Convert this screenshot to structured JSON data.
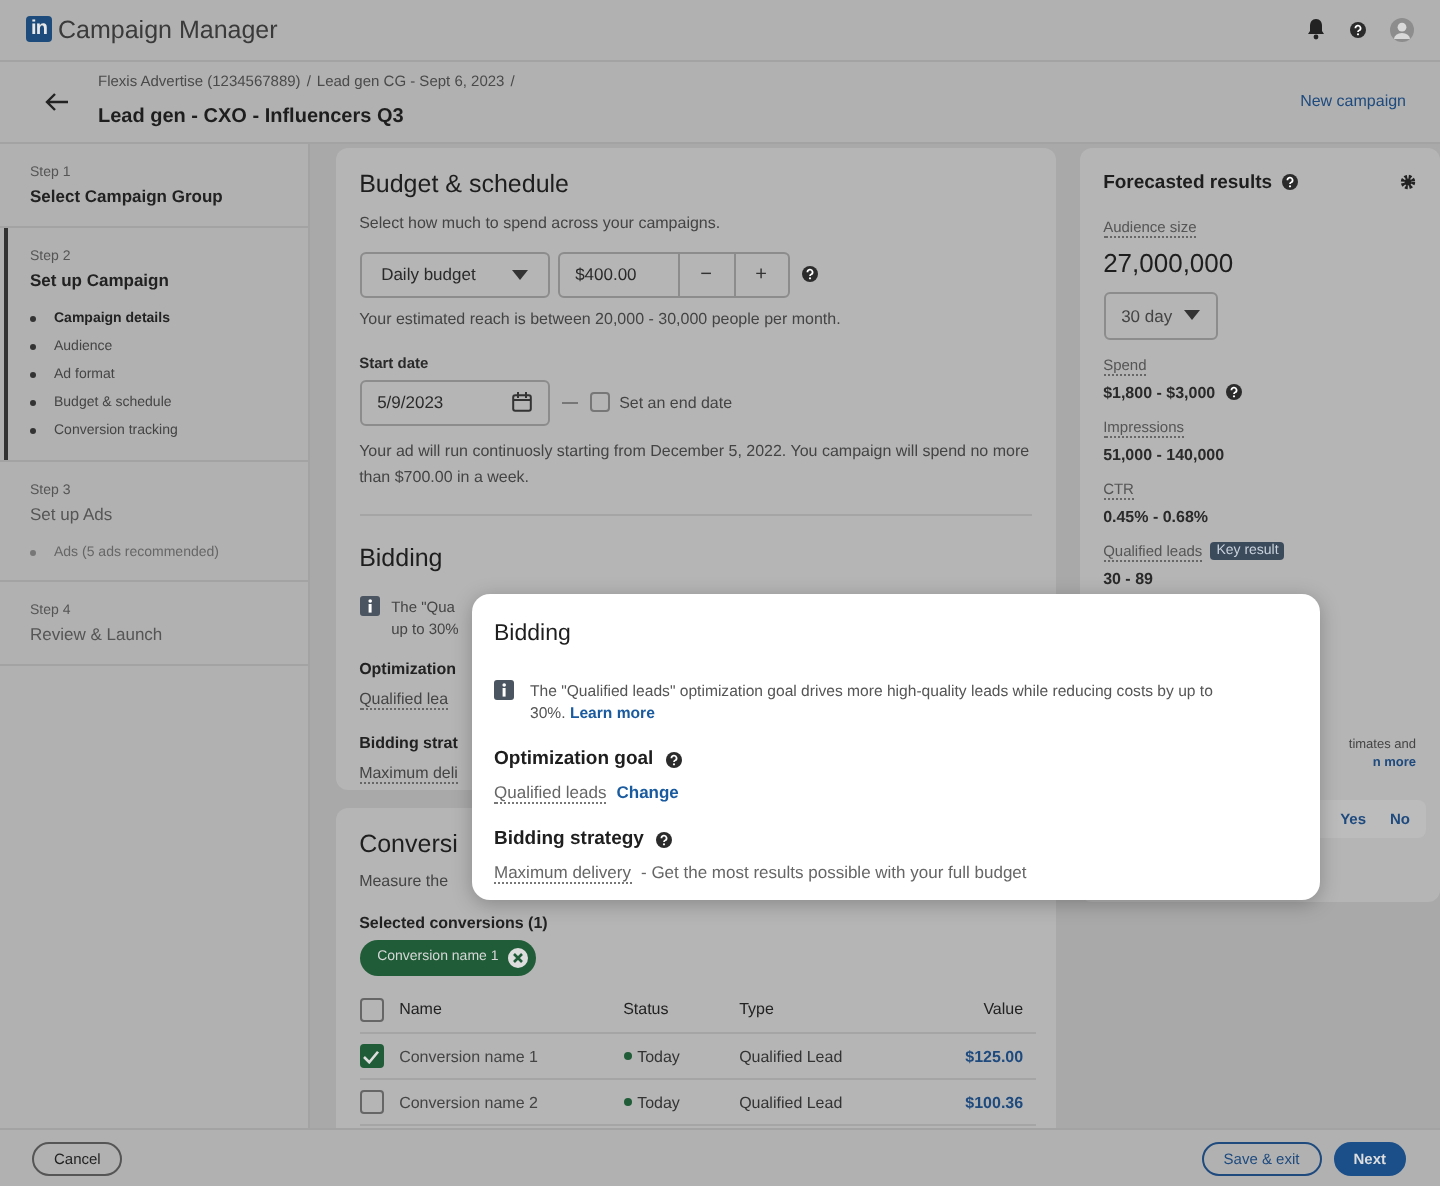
{
  "app": {
    "logo": "in",
    "title": "Campaign Manager"
  },
  "header": {
    "breadcrumbs": [
      "Flexis Advertise (1234567889)",
      "Lead gen CG - Sept 6, 2023"
    ],
    "separator": "/",
    "title": "Lead gen - CXO - Influencers Q3",
    "action": "New campaign"
  },
  "steps": [
    {
      "label": "Step 1",
      "title": "Select Campaign Group",
      "selected": false,
      "disabled": false
    },
    {
      "label": "Step 2",
      "title": "Set up Campaign",
      "selected": true,
      "disabled": false,
      "substeps": [
        {
          "label": "Campaign details",
          "selected": true
        },
        {
          "label": "Audience",
          "selected": false
        },
        {
          "label": "Ad format",
          "selected": false
        },
        {
          "label": "Budget & schedule",
          "selected": false
        },
        {
          "label": "Conversion tracking",
          "selected": false
        }
      ]
    },
    {
      "label": "Step 3",
      "title": "Set up Ads",
      "selected": false,
      "disabled": true,
      "substeps": [
        {
          "label": "Ads (5 ads recommended)",
          "selected": false
        }
      ]
    },
    {
      "label": "Step 4",
      "title": "Review & Launch",
      "selected": false,
      "disabled": true
    }
  ],
  "budget": {
    "title": "Budget & schedule",
    "description": "Select how much to spend across your campaigns.",
    "budget_type": "Daily budget",
    "amount": "$400.00",
    "minus": "−",
    "plus": "+",
    "reach": "Your estimated reach is between 20,000 - 30,000 people per month.",
    "start_date_label": "Start date",
    "start_date": "5/9/2023",
    "end_date": {
      "label": "Set an end date",
      "checked": false
    },
    "schedule_note": "Your ad will run continuosly starting from December 5, 2022. You campaign will spend no more than $700.00 in a week."
  },
  "bidding": {
    "title": "Bidding",
    "info_lines": [
      "The \"Qua",
      "up to 30%"
    ],
    "goal_label": "Optimization",
    "goal_value": "Qualified lea",
    "strategy_label": "Bidding strat",
    "strategy_value": "Maximum deli"
  },
  "conversions": {
    "title": "Conversi",
    "description": "Measure the",
    "selected_label": "Selected conversions (1)",
    "chips": [
      "Conversion name 1"
    ],
    "table": {
      "all_checked": false,
      "columns": [
        "Name",
        "Status",
        "Type",
        "Value"
      ],
      "rows": [
        {
          "checked": true,
          "name": "Conversion name 1",
          "status": "Today",
          "type": "Qualified Lead",
          "value": "$125.00"
        },
        {
          "checked": false,
          "name": "Conversion name 2",
          "status": "Today",
          "type": "Qualified Lead",
          "value": "$100.36"
        }
      ]
    }
  },
  "forecast": {
    "title": "Forecasted results",
    "audience": {
      "label": "Audience size",
      "value": "27,000,000"
    },
    "period": "30 day",
    "metrics": [
      {
        "label": "Spend",
        "value": "$1,800 - $3,000",
        "help": true
      },
      {
        "label": "Impressions",
        "value": "51,000 - 140,000",
        "help": false
      },
      {
        "label": "CTR",
        "value": "0.45% - 0.68%",
        "help": false
      },
      {
        "label": "Qualified leads",
        "badge": "Key result",
        "value": "30 - 89",
        "help": false
      }
    ],
    "note_lines": [
      "timates and",
      "n more"
    ],
    "feedback": [
      "Yes",
      "No"
    ]
  },
  "popover": {
    "title": "Bidding",
    "info": "The \"Qualified leads\" optimization goal drives more high-quality leads while reducing costs by up to 30%.",
    "link": "Learn more",
    "goal_label": "Optimization goal",
    "goal_value": "Qualified leads",
    "goal_action": "Change",
    "strategy_label": "Bidding strategy",
    "strategy_value": "Maximum delivery",
    "strategy_desc": "- Get the most results possible with your full budget"
  },
  "footer": {
    "cancel": "Cancel",
    "save": "Save & exit",
    "next": "Next"
  }
}
